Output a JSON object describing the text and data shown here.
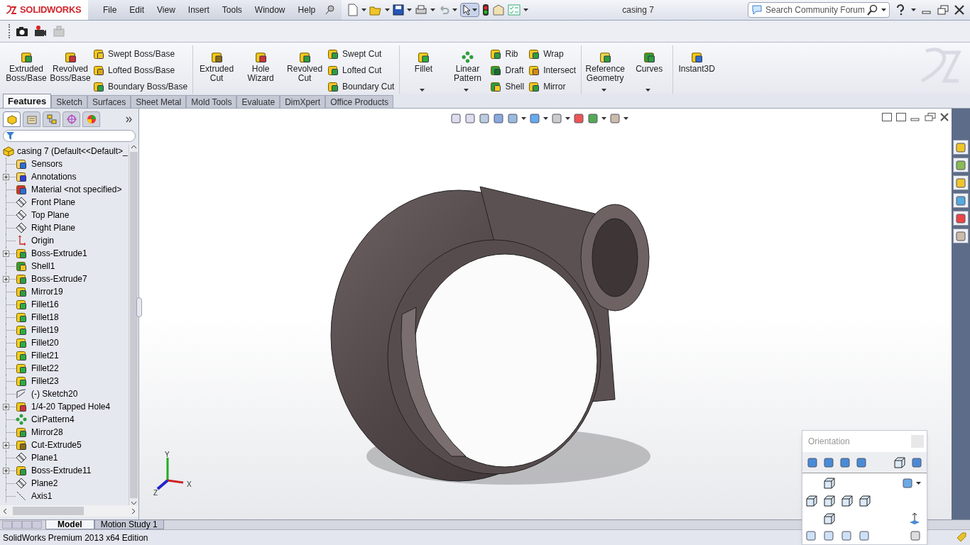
{
  "app": {
    "logo": "SOLIDWORKS",
    "title": "casing 7"
  },
  "menu": [
    "File",
    "Edit",
    "View",
    "Insert",
    "Tools",
    "Window",
    "Help"
  ],
  "search": {
    "placeholder": "Search Community Forum"
  },
  "ribbon": [
    {
      "columns": [
        {
          "kind": "large",
          "label": "Extruded Boss/Base",
          "dropdown": false
        },
        {
          "kind": "large",
          "label": "Revolved Boss/Base",
          "dropdown": false
        },
        {
          "kind": "stack",
          "items": [
            {
              "label": "Swept Boss/Base"
            },
            {
              "label": "Lofted Boss/Base"
            },
            {
              "label": "Boundary Boss/Base"
            }
          ]
        }
      ]
    },
    {
      "columns": [
        {
          "kind": "large",
          "label": "Extruded Cut",
          "dropdown": false
        },
        {
          "kind": "large",
          "label": "Hole Wizard",
          "dropdown": false
        },
        {
          "kind": "large",
          "label": "Revolved Cut",
          "dropdown": false
        },
        {
          "kind": "stack",
          "items": [
            {
              "label": "Swept Cut"
            },
            {
              "label": "Lofted Cut"
            },
            {
              "label": "Boundary Cut"
            }
          ]
        }
      ]
    },
    {
      "columns": [
        {
          "kind": "large",
          "label": "Fillet",
          "dropdown": true
        },
        {
          "kind": "large",
          "label": "Linear Pattern",
          "dropdown": true
        },
        {
          "kind": "stack",
          "items": [
            {
              "label": "Rib"
            },
            {
              "label": "Draft"
            },
            {
              "label": "Shell"
            }
          ]
        },
        {
          "kind": "stack",
          "items": [
            {
              "label": "Wrap"
            },
            {
              "label": "Intersect"
            },
            {
              "label": "Mirror"
            }
          ]
        }
      ]
    },
    {
      "columns": [
        {
          "kind": "large",
          "label": "Reference Geometry",
          "dropdown": true
        },
        {
          "kind": "large",
          "label": "Curves",
          "dropdown": true
        }
      ]
    },
    {
      "columns": [
        {
          "kind": "large",
          "label": "Instant3D",
          "dropdown": false
        }
      ]
    }
  ],
  "command_tabs": [
    {
      "label": "Features",
      "selected": true
    },
    {
      "label": "Sketch",
      "selected": false
    },
    {
      "label": "Surfaces",
      "selected": false
    },
    {
      "label": "Sheet Metal",
      "selected": false
    },
    {
      "label": "Mold Tools",
      "selected": false
    },
    {
      "label": "Evaluate",
      "selected": false
    },
    {
      "label": "DimXpert",
      "selected": false
    },
    {
      "label": "Office Products",
      "selected": false
    }
  ],
  "panel_tabs": [
    {
      "selected": true
    },
    {
      "selected": false
    },
    {
      "selected": false
    },
    {
      "selected": false
    },
    {
      "selected": false
    }
  ],
  "tree": {
    "root": "casing 7  (Default<<Default>_",
    "items": [
      {
        "label": "Sensors",
        "kind": "sensor",
        "expandable": false
      },
      {
        "label": "Annotations",
        "kind": "annotation",
        "expandable": true
      },
      {
        "label": "Material <not specified>",
        "kind": "material",
        "expandable": false
      },
      {
        "label": "Front Plane",
        "kind": "plane",
        "expandable": false
      },
      {
        "label": "Top Plane",
        "kind": "plane",
        "expandable": false
      },
      {
        "label": "Right Plane",
        "kind": "plane",
        "expandable": false
      },
      {
        "label": "Origin",
        "kind": "origin",
        "expandable": false
      },
      {
        "label": "Boss-Extrude1",
        "kind": "boss",
        "expandable": true
      },
      {
        "label": "Shell1",
        "kind": "shell",
        "expandable": false
      },
      {
        "label": "Boss-Extrude7",
        "kind": "boss",
        "expandable": true
      },
      {
        "label": "Mirror19",
        "kind": "mirror",
        "expandable": false
      },
      {
        "label": "Fillet16",
        "kind": "fillet",
        "expandable": false
      },
      {
        "label": "Fillet18",
        "kind": "fillet",
        "expandable": false
      },
      {
        "label": "Fillet19",
        "kind": "fillet",
        "expandable": false
      },
      {
        "label": "Fillet20",
        "kind": "fillet",
        "expandable": false
      },
      {
        "label": "Fillet21",
        "kind": "fillet",
        "expandable": false
      },
      {
        "label": "Fillet22",
        "kind": "fillet",
        "expandable": false
      },
      {
        "label": "Fillet23",
        "kind": "fillet",
        "expandable": false
      },
      {
        "label": "(-) Sketch20",
        "kind": "sketch",
        "expandable": false
      },
      {
        "label": "1/4-20 Tapped Hole4",
        "kind": "hole",
        "expandable": true
      },
      {
        "label": "CirPattern4",
        "kind": "pattern",
        "expandable": false
      },
      {
        "label": "Mirror28",
        "kind": "mirror",
        "expandable": false
      },
      {
        "label": "Cut-Extrude5",
        "kind": "cut",
        "expandable": true
      },
      {
        "label": "Plane1",
        "kind": "plane",
        "expandable": false
      },
      {
        "label": "Boss-Extrude11",
        "kind": "boss",
        "expandable": true
      },
      {
        "label": "Plane2",
        "kind": "plane",
        "expandable": false
      },
      {
        "label": "Axis1",
        "kind": "axis",
        "expandable": false
      }
    ]
  },
  "bottom_tabs": [
    {
      "label": "Model",
      "selected": true
    },
    {
      "label": "Motion Study 1",
      "selected": false
    }
  ],
  "triad": {
    "x": "X",
    "y": "Y",
    "z": "Z"
  },
  "orientation": {
    "title": "Orientation"
  },
  "status_bar": "SolidWorks Premium 2013 x64 Edition"
}
